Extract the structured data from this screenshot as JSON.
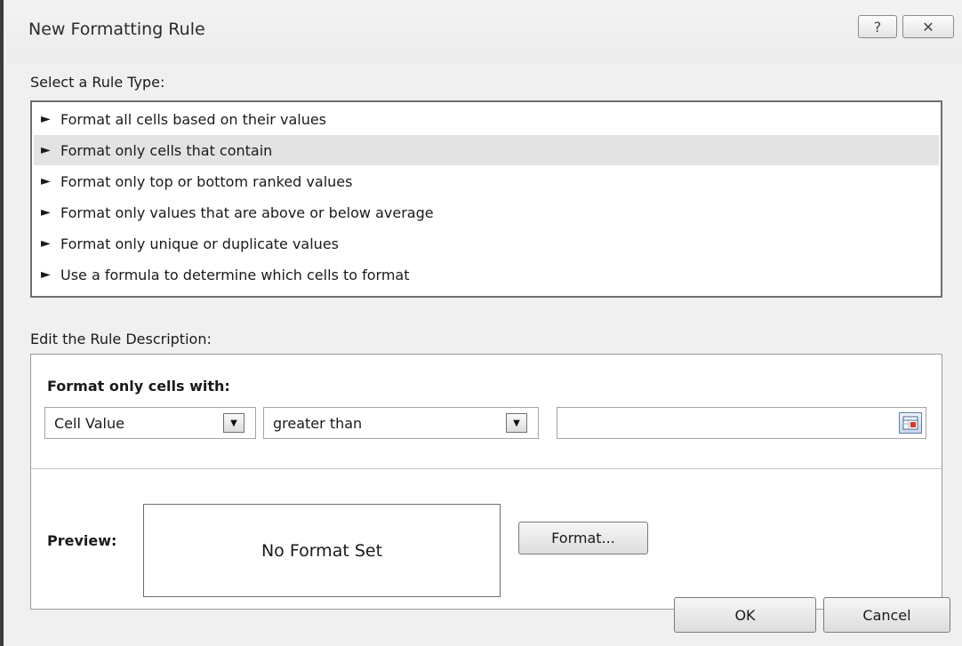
{
  "dialog": {
    "title": "New Formatting Rule",
    "help_glyph": "?",
    "close_glyph": "✕"
  },
  "rule_type": {
    "label": "Select a Rule Type:",
    "selected_index": 1,
    "items": [
      {
        "label": "Format all cells based on their values"
      },
      {
        "label": "Format only cells that contain"
      },
      {
        "label": "Format only top or bottom ranked values"
      },
      {
        "label": "Format only values that are above or below average"
      },
      {
        "label": "Format only unique or duplicate values"
      },
      {
        "label": "Use a formula to determine which cells to format"
      }
    ],
    "arrow_glyph": "►"
  },
  "description": {
    "label": "Edit the Rule Description:",
    "heading": "Format only cells with:",
    "condition_type": "Cell Value",
    "operator": "greater than",
    "value": "",
    "preview_label": "Preview:",
    "preview_text": "No Format Set",
    "format_button": "Format..."
  },
  "buttons": {
    "ok": "OK",
    "cancel": "Cancel"
  },
  "icons": {
    "help": "help-icon",
    "close": "close-icon",
    "dropdown": "chevron-down-icon",
    "range_picker": "collapse-dialog-icon"
  },
  "colors": {
    "selected_row": "#e3e3e3",
    "dialog_bg": "#f0f0f0"
  }
}
